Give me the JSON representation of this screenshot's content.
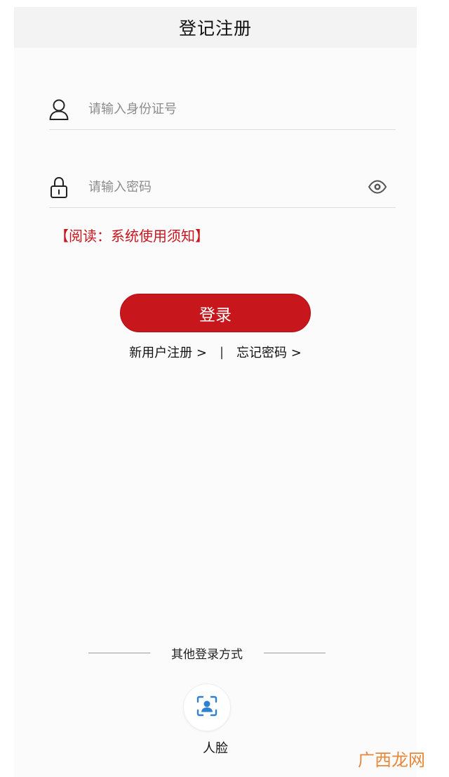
{
  "header": {
    "title": "登记注册"
  },
  "form": {
    "id_field": {
      "placeholder": "请输入身份证号",
      "value": ""
    },
    "password_field": {
      "placeholder": "请输入密码",
      "value": ""
    }
  },
  "notice": {
    "text": "【阅读：系统使用须知】"
  },
  "login_button": {
    "label": "登录"
  },
  "links": {
    "register": "新用户注册 >",
    "separator": "|",
    "forgot": "忘记密码 >"
  },
  "other_login": {
    "label": "其他登录方式",
    "face_label": "人脸"
  },
  "watermark": {
    "text": "广西龙网"
  },
  "colors": {
    "accent": "#c8161d",
    "face_icon": "#2f80d0",
    "watermark": "#e6873a"
  },
  "icons": {
    "user": "user-icon",
    "lock": "lock-icon",
    "eye": "eye-icon",
    "face": "face-scan-icon"
  }
}
